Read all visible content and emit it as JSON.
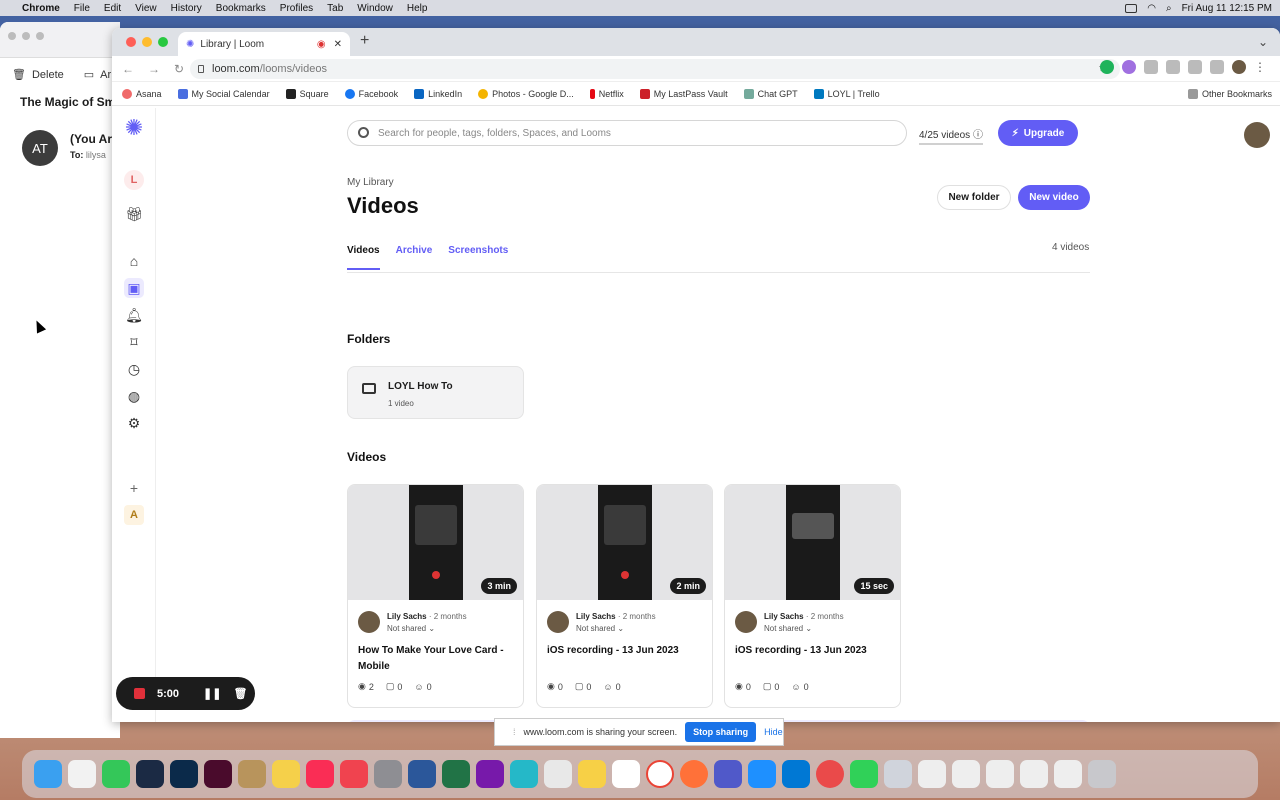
{
  "menubar": {
    "app": "Chrome",
    "items": [
      "File",
      "Edit",
      "View",
      "History",
      "Bookmarks",
      "Profiles",
      "Tab",
      "Window",
      "Help"
    ],
    "datetime": "Fri Aug 11  12:15 PM"
  },
  "mail": {
    "delete_label": "Delete",
    "archive_label": "Ar",
    "subject": "The Magic of Sma",
    "avatar_initials": "AT",
    "from": "(You Are",
    "to_label": "To:",
    "to_value": "lilysa"
  },
  "browser": {
    "tab_title": "Library | Loom",
    "url_host": "loom.com",
    "url_path": "/looms/videos",
    "bookmarks": [
      "Asana",
      "My Social Calendar",
      "Square",
      "Facebook",
      "LinkedIn",
      "Photos - Google D...",
      "Netflix",
      "My LastPass Vault",
      "Chat GPT",
      "LOYL | Trello"
    ],
    "other_bookmarks": "Other Bookmarks"
  },
  "rail": {
    "workspace_initial": "L",
    "workspace_bottom_initial": "A",
    "add": "+"
  },
  "header": {
    "search_placeholder": "Search for people, tags, folders, Spaces, and Looms",
    "quota": "4/25 videos",
    "upgrade_label": "Upgrade"
  },
  "page": {
    "breadcrumb": "My Library",
    "title": "Videos",
    "new_folder": "New folder",
    "new_video": "New video",
    "tabs": [
      "Videos",
      "Archive",
      "Screenshots"
    ],
    "video_count": "4 videos",
    "folders_heading": "Folders",
    "videos_heading": "Videos"
  },
  "folder": {
    "name": "LOYL How To",
    "count": "1 video"
  },
  "videos": [
    {
      "duration": "3 min",
      "author": "Lily Sachs",
      "ago": "· 2 months",
      "shared": "Not shared ⌄",
      "title": "How To Make Your Love Card - Mobile",
      "views": "2",
      "comments": "0",
      "reactions": "0"
    },
    {
      "duration": "2 min",
      "author": "Lily Sachs",
      "ago": "· 2 months",
      "shared": "Not shared ⌄",
      "title": "iOS recording - 13 Jun 2023",
      "views": "0",
      "comments": "0",
      "reactions": "0"
    },
    {
      "duration": "15 sec",
      "author": "Lily Sachs",
      "ago": "· 2 months",
      "shared": "Not shared ⌄",
      "title": "iOS recording - 13 Jun 2023",
      "views": "0",
      "comments": "0",
      "reactions": "0"
    }
  ],
  "recorder": {
    "time": "5:00"
  },
  "sharebar": {
    "message": "www.loom.com is sharing your screen.",
    "stop_label": "Stop sharing",
    "hide_label": "Hide"
  },
  "help": "?",
  "colors": {
    "accent": "#625df5",
    "stop": "#1a73e8",
    "record": "#e0303a"
  }
}
